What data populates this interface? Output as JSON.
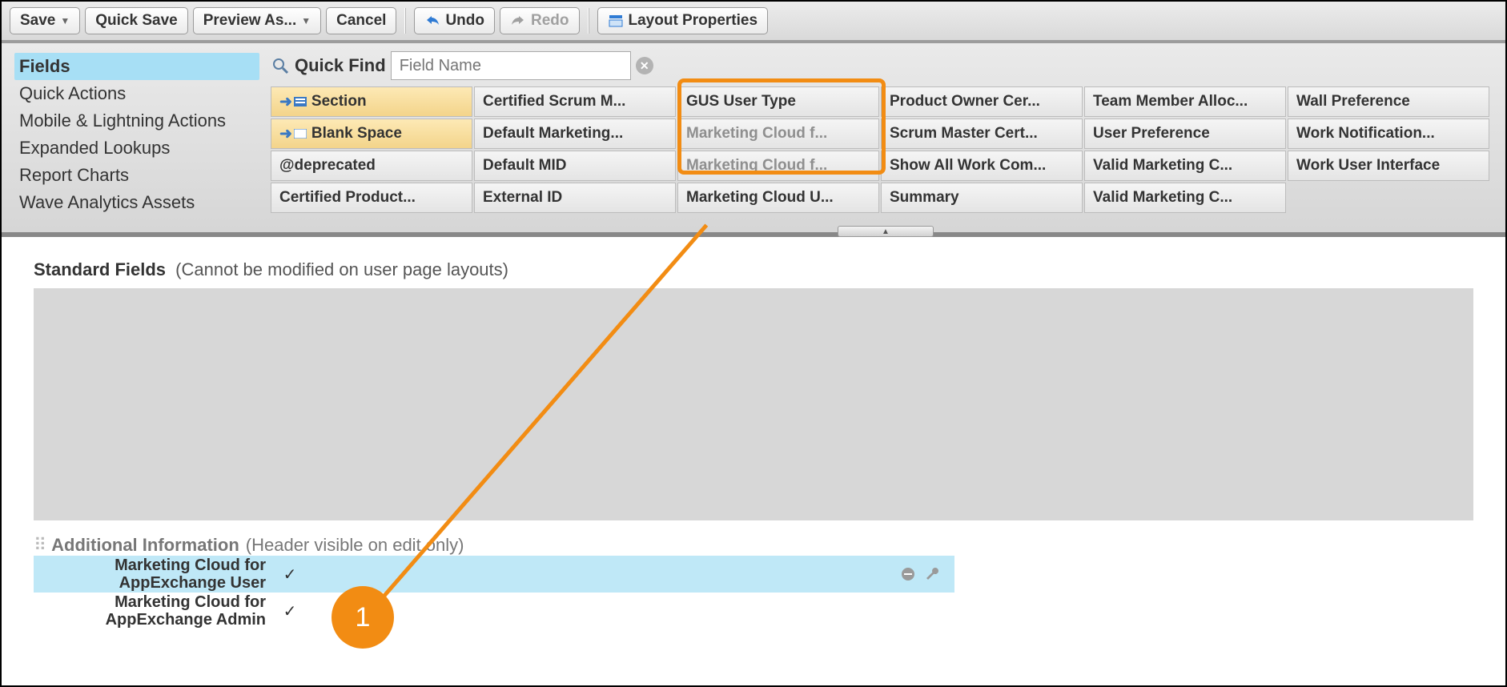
{
  "toolbar": {
    "save": "Save",
    "quick_save": "Quick Save",
    "preview_as": "Preview As...",
    "cancel": "Cancel",
    "undo": "Undo",
    "redo": "Redo",
    "layout_props": "Layout Properties"
  },
  "sidebar": {
    "items": [
      "Fields",
      "Quick Actions",
      "Mobile & Lightning Actions",
      "Expanded Lookups",
      "Report Charts",
      "Wave Analytics Assets"
    ],
    "selected_index": 0
  },
  "quick_find": {
    "label": "Quick Find",
    "placeholder": "Field Name",
    "value": ""
  },
  "palette": {
    "cols": [
      [
        {
          "label": "Section",
          "special": true,
          "icon": "section"
        },
        {
          "label": "Blank Space",
          "special": true,
          "icon": "blank"
        },
        {
          "label": "@deprecated"
        },
        {
          "label": "Certified Product..."
        }
      ],
      [
        {
          "label": "Certified Scrum M..."
        },
        {
          "label": "Default Marketing..."
        },
        {
          "label": "Default MID"
        },
        {
          "label": "External ID"
        }
      ],
      [
        {
          "label": "GUS User Type"
        },
        {
          "label": "Marketing Cloud f...",
          "dim": true
        },
        {
          "label": "Marketing Cloud f...",
          "dim": true
        },
        {
          "label": "Marketing Cloud U..."
        }
      ],
      [
        {
          "label": "Product Owner Cer..."
        },
        {
          "label": "Scrum Master Cert..."
        },
        {
          "label": "Show All Work Com..."
        },
        {
          "label": "Summary"
        }
      ],
      [
        {
          "label": "Team Member Alloc..."
        },
        {
          "label": "User Preference"
        },
        {
          "label": "Valid Marketing C..."
        },
        {
          "label": "Valid Marketing C..."
        }
      ],
      [
        {
          "label": "Wall Preference"
        },
        {
          "label": "Work Notification..."
        },
        {
          "label": "Work User Interface"
        }
      ]
    ]
  },
  "standard_fields": {
    "title": "Standard Fields",
    "sub": "(Cannot be modified on user page layouts)"
  },
  "additional_info": {
    "title": "Additional Information",
    "sub": "(Header visible on edit only)",
    "rows": [
      {
        "label": "Marketing Cloud for AppExchange User",
        "checked": true,
        "selected": true
      },
      {
        "label": "Marketing Cloud for AppExchange Admin",
        "checked": true,
        "selected": false
      }
    ]
  },
  "annotation": {
    "number": "1"
  }
}
